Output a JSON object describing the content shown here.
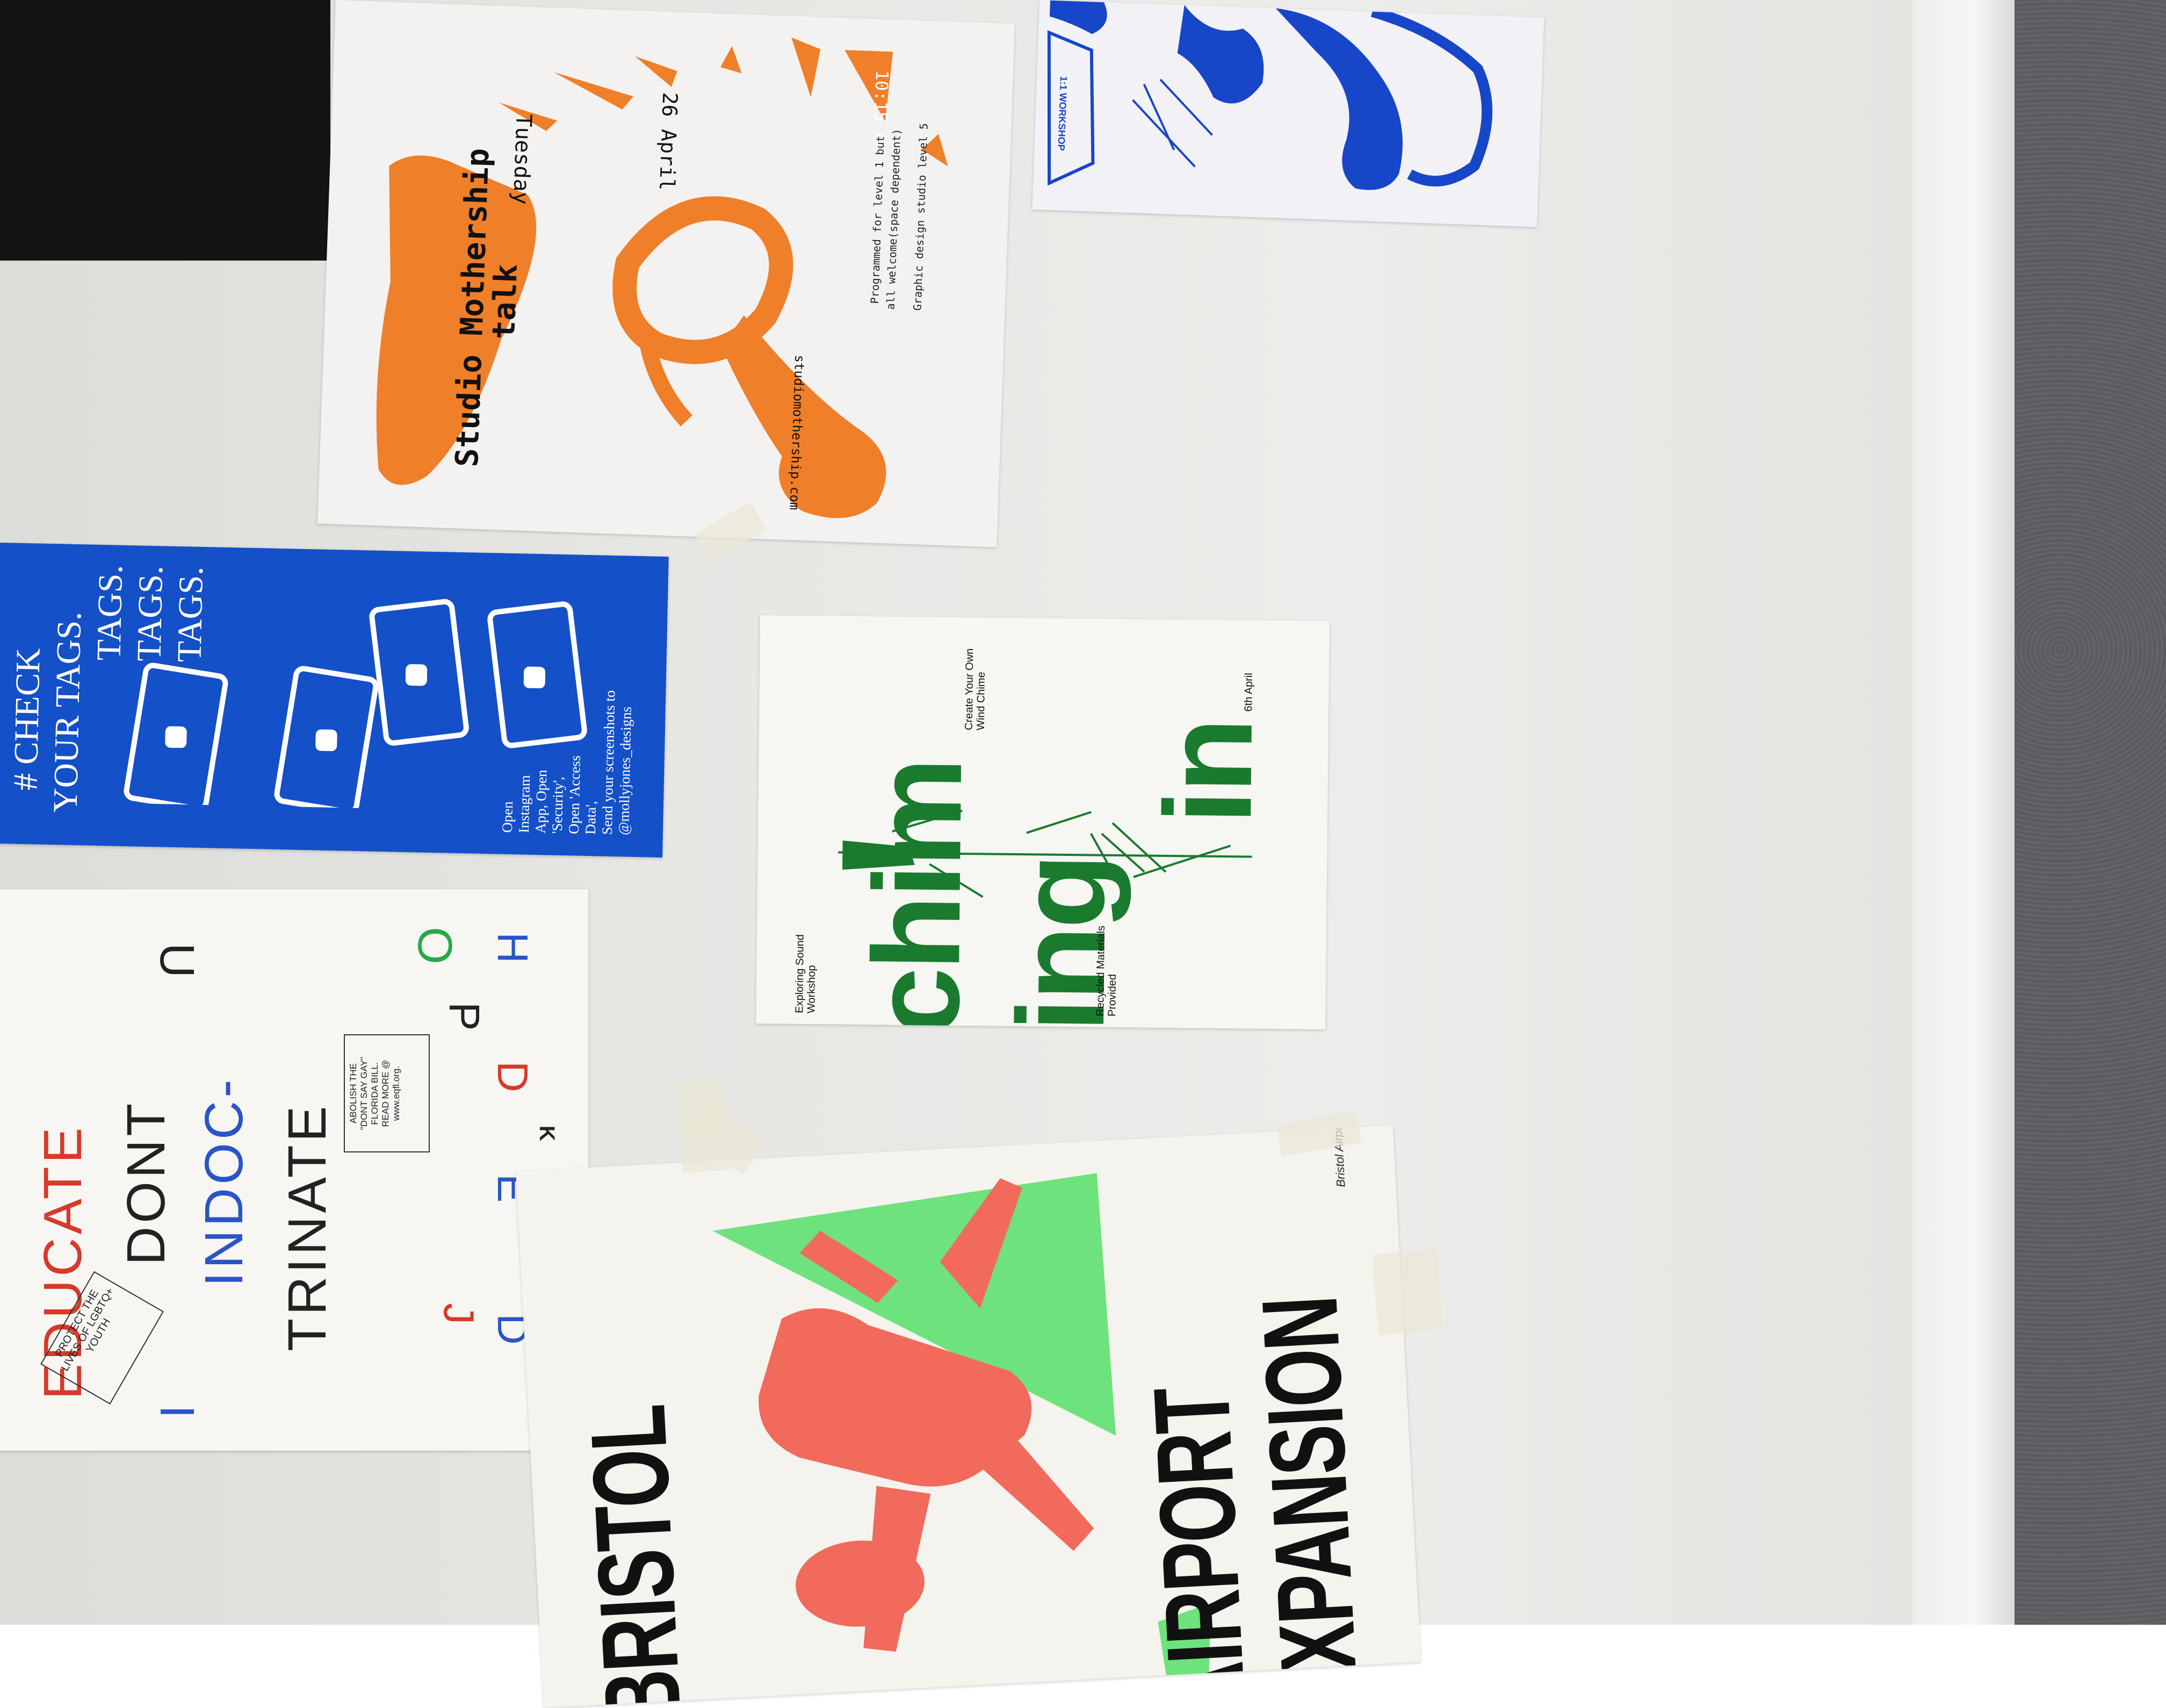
{
  "colors": {
    "orange": "#f07f2a",
    "blue": "#1746c8",
    "green": "#1a7a2e",
    "pink": "#f26a5c",
    "lime": "#5fe070",
    "black": "#111111"
  },
  "mothership": {
    "title_line1": "Studio Mothership",
    "title_line2": "talk",
    "day": "Tuesday",
    "date": "26 April",
    "time": "10:15 AM",
    "url": "studiomothership.com",
    "info_line1": "Programmed for level 1 but",
    "info_line2": "all welcome(space dependent)",
    "info_line3": "Graphic design studio level 5"
  },
  "tags": {
    "line1": "# CHECK",
    "line2": "YOUR TAGS.",
    "line3": "TAGS.",
    "line4": "TAGS.",
    "line5": "TAGS.",
    "body_lines": [
      "Open",
      "Instagram",
      "App, Open",
      "'Security',",
      "Open 'Access",
      "Data',",
      "Send your screenshots to",
      "@mollyjones_designs"
    ]
  },
  "educate": {
    "col1": "EDUCATE",
    "col2": "DONT",
    "col3": "INDOC-",
    "col4": "TRINATE",
    "stray1": "I",
    "stray2": "U",
    "stray3": "O",
    "row_h": "H",
    "row_p": "P",
    "row_d": "D",
    "row_e": "E",
    "row_k": "K",
    "row_j": "J",
    "row_d2": "D",
    "box1": "PROTECT THE LIVES OF LGBTQ+ YOUTH",
    "box2_lines": [
      "ABOLISH THE",
      "\"DONT SAY GAY\"",
      "FLORIDA BILL.",
      "READ MORE @",
      "www.eqfl.org."
    ]
  },
  "chiming": {
    "line1": "chim",
    "line2": "ing",
    "line3": "in",
    "top_label": "Exploring Sound Workshop",
    "mid_label": "Create Your Own Wind Chime",
    "bottom_label": "Recycled Materials Provided",
    "date": "6th April"
  },
  "workshop": {
    "label": "1:1 WORKSHOP"
  },
  "bristol": {
    "word1": "BRISTOL",
    "word2": "AIRPORT",
    "word3": "EXPANSION",
    "signature": "Bristol Airport"
  }
}
